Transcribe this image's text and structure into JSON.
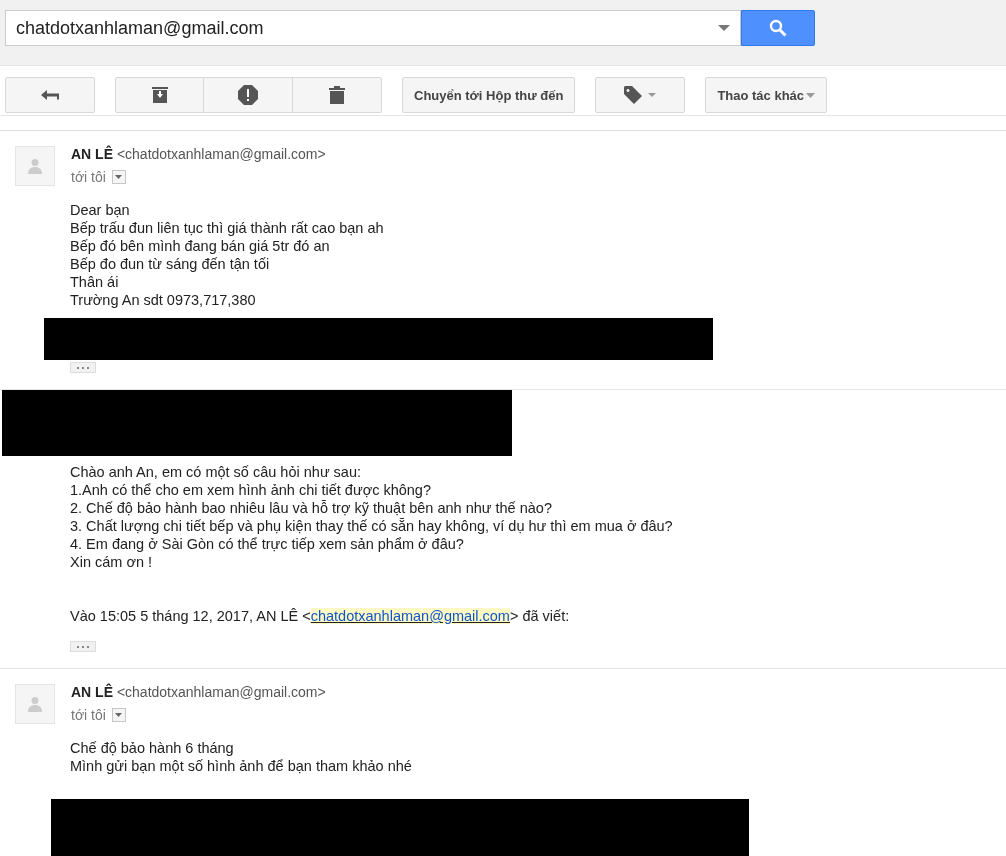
{
  "search": {
    "value": "chatdotxanhlaman@gmail.com"
  },
  "toolbar": {
    "move_button": "Chuyển tới Hộp thư đến",
    "more_button": "Thao tác khác"
  },
  "messages": [
    {
      "header_redacted": false,
      "sender": "AN LÊ",
      "email": "<chatdotxanhlaman@gmail.com>",
      "to": "tới tôi",
      "body": [
        "Dear bạn",
        "Bếp trấu đun liên tục thì giá thành rất cao bạn ah",
        "Bếp đó bên mình đang bán giá 5tr đó an",
        "Bếp đo đun từ sáng đến tận tối",
        "Thân ái",
        "Trường An sdt 0973,717,380"
      ],
      "footer_redacted": true,
      "trimmed": true
    },
    {
      "header_redacted": true,
      "body": [
        "Chào anh An, em có một số câu hỏi như sau:",
        "1.Anh có thể cho em xem hình ảnh chi tiết được không?",
        "2. Chế độ bảo hành bao nhiêu lâu và hỗ trợ kỹ thuật bên anh như thế nào?",
        "3. Chất lượng chi tiết bếp và phụ kiện thay thế có sẵn hay không, ví dụ hư thì em mua ở đâu?",
        "4. Em đang ở Sài Gòn có thể trực tiếp xem sản phẩm ở đâu?",
        "Xin cám ơn !"
      ],
      "quote": {
        "before": "Vào 15:05 5 tháng 12, 2017, AN LÊ <",
        "link": "chatdotxanhlaman@gmail.com",
        "after": "> đã viết:"
      },
      "footer_redacted": false,
      "trimmed": true
    },
    {
      "header_redacted": false,
      "sender": "AN LÊ",
      "email": "<chatdotxanhlaman@gmail.com>",
      "to": "tới tôi",
      "body": [
        "Chế độ bảo hành 6 tháng",
        "Mình gửi bạn một số hình ảnh để bạn tham khảo nhé"
      ],
      "footer_redacted": true,
      "trimmed": false
    }
  ]
}
